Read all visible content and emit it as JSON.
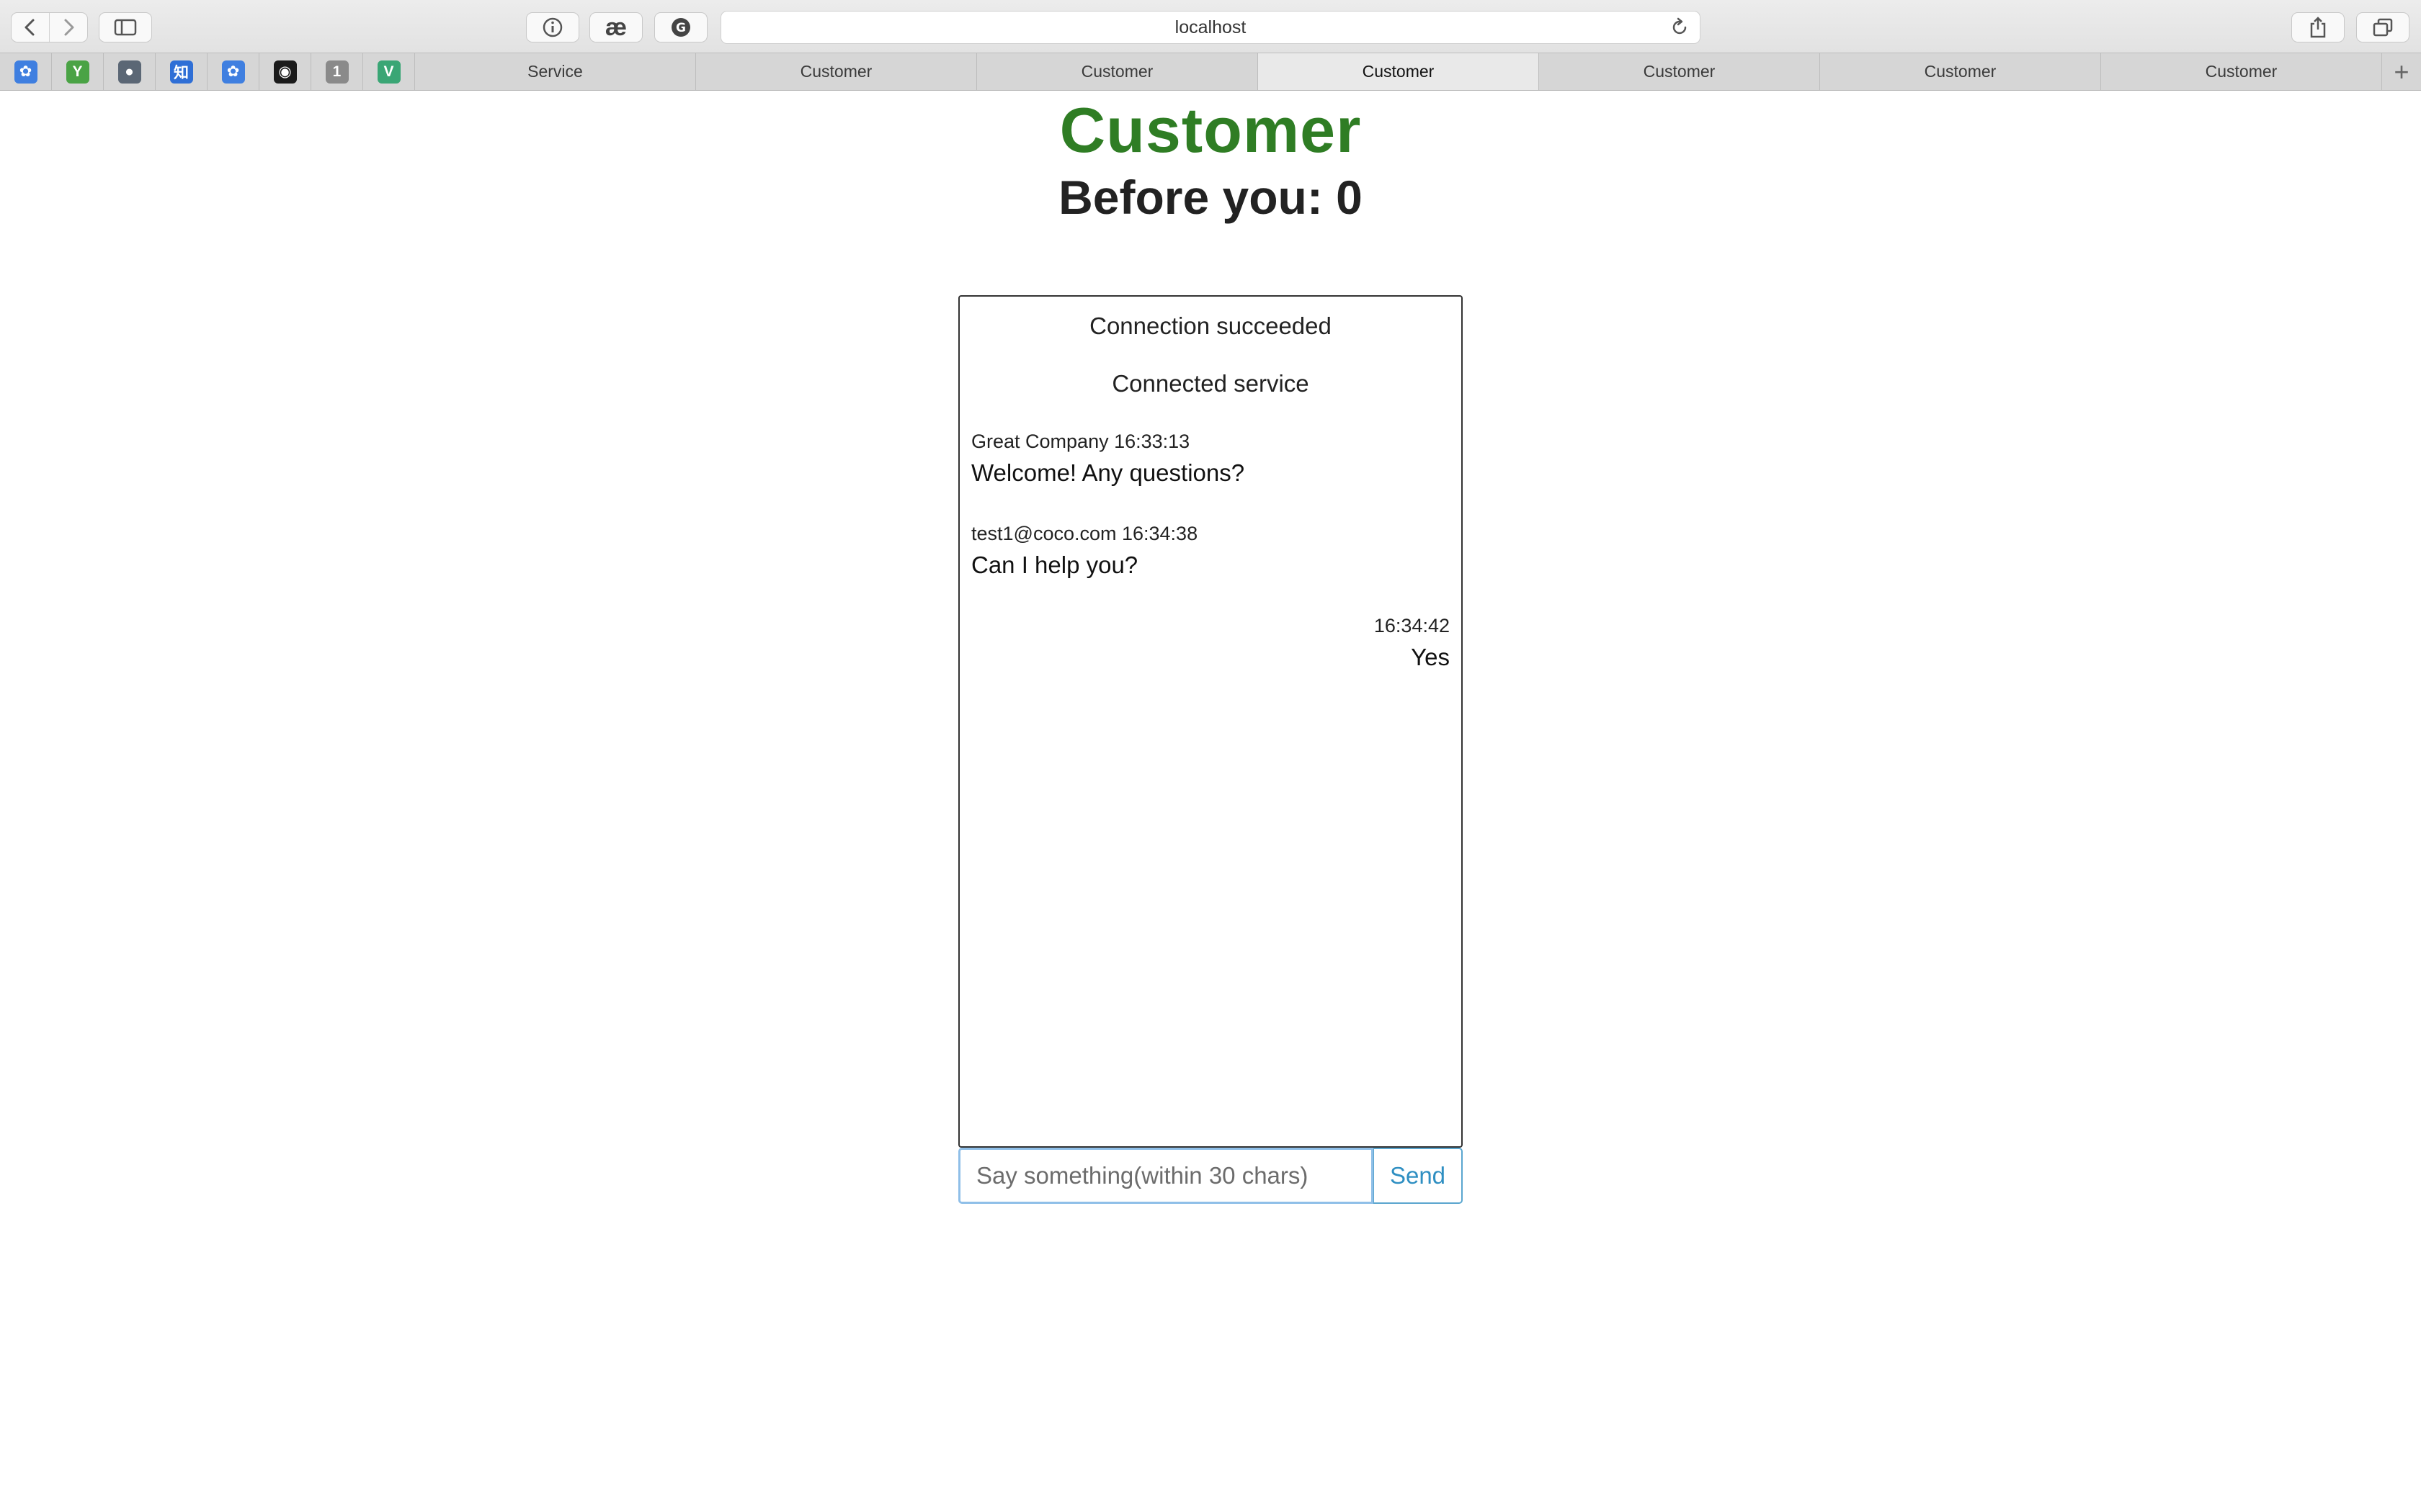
{
  "browser": {
    "url": "localhost",
    "pinned_tabs": [
      {
        "icon": "baidu-paw-icon",
        "color": "#3f7fe0",
        "glyph": "✿"
      },
      {
        "icon": "green-app-icon",
        "color": "#4aa345",
        "glyph": "Y"
      },
      {
        "icon": "globe-app-icon",
        "color": "#5b6775",
        "glyph": "●"
      },
      {
        "icon": "zhihu-icon",
        "color": "#2f6fd6",
        "glyph": "知"
      },
      {
        "icon": "baidu-paw-icon",
        "color": "#3f7fe0",
        "glyph": "✿"
      },
      {
        "icon": "github-icon",
        "color": "#1b1b1b",
        "glyph": "◉"
      },
      {
        "icon": "onepassword-icon",
        "color": "#8a8a8a",
        "glyph": "1"
      },
      {
        "icon": "vue-icon",
        "color": "#3aa675",
        "glyph": "V"
      }
    ],
    "tabs": [
      {
        "label": "Service",
        "active": false
      },
      {
        "label": "Customer",
        "active": false
      },
      {
        "label": "Customer",
        "active": false
      },
      {
        "label": "Customer",
        "active": true
      },
      {
        "label": "Customer",
        "active": false
      },
      {
        "label": "Customer",
        "active": false
      },
      {
        "label": "Customer",
        "active": false
      }
    ]
  },
  "page": {
    "title": "Customer",
    "queue_label": "Before you: 0",
    "title_color": "#2f7d24"
  },
  "chat": {
    "notices": [
      "Connection succeeded",
      "Connected service"
    ],
    "messages": [
      {
        "side": "left",
        "meta": "Great Company 16:33:13",
        "text": "Welcome! Any questions?"
      },
      {
        "side": "left",
        "meta": "test1@coco.com 16:34:38",
        "text": "Can I help you?"
      },
      {
        "side": "right",
        "meta": "16:34:42",
        "text": "Yes"
      }
    ]
  },
  "composer": {
    "placeholder": "Say something(within 30 chars)",
    "value": "",
    "send_label": "Send"
  }
}
